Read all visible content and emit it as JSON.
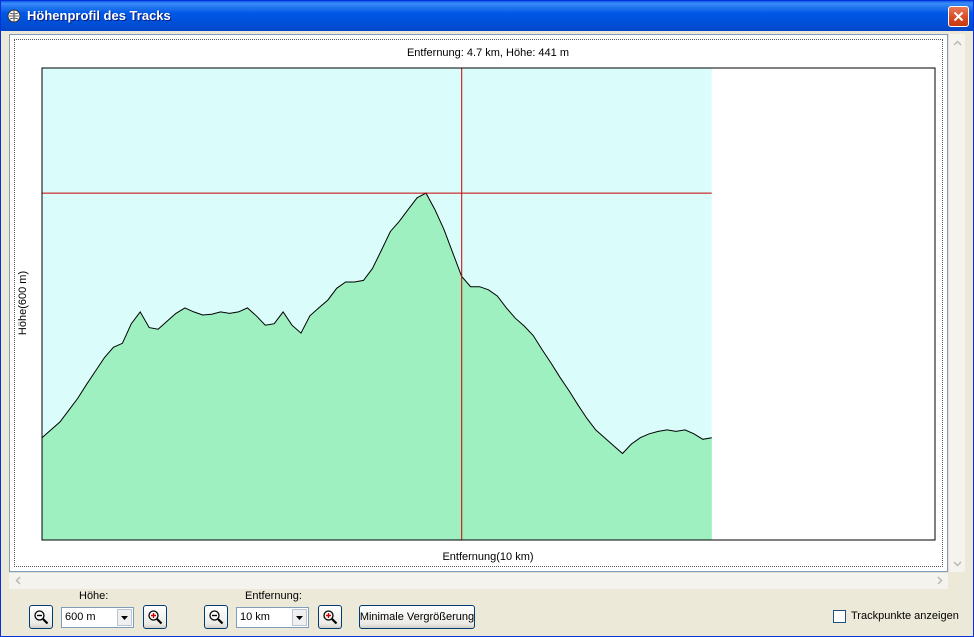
{
  "window": {
    "title": "Höhenprofil des Tracks"
  },
  "chart": {
    "readout": "Entfernung: 4.7 km, Höhe: 441 m",
    "xlabel": "Entfernung(10 km)",
    "ylabel": "Höhe(600 m)"
  },
  "chart_data": {
    "type": "area",
    "title": "Entfernung: 4.7 km, Höhe: 441 m",
    "xlabel": "Entfernung(10 km)",
    "ylabel": "Höhe(600 m)",
    "xlim": [
      0,
      10
    ],
    "ylim": [
      0,
      600
    ],
    "grid": false,
    "cursor": {
      "x": 4.7,
      "y": 441
    },
    "colors": {
      "sky": "#DAFDFC",
      "fill": "#9EF0C0",
      "line": "#000000",
      "cursor": "#CC0000"
    },
    "series": [
      {
        "x": [
          0,
          0.1,
          0.2,
          0.3,
          0.4,
          0.5,
          0.6,
          0.7,
          0.8,
          0.9,
          1.0,
          1.1,
          1.2,
          1.3,
          1.4,
          1.5,
          1.6,
          1.7,
          1.8,
          1.9,
          2.0,
          2.1,
          2.2,
          2.3,
          2.4,
          2.5,
          2.6,
          2.7,
          2.8,
          2.9,
          3.0,
          3.1,
          3.2,
          3.3,
          3.4,
          3.5,
          3.6,
          3.7,
          3.8,
          3.9,
          4.0,
          4.1,
          4.2,
          4.3,
          4.4,
          4.5,
          4.6,
          4.7,
          4.8,
          4.9,
          5.0,
          5.1,
          5.2,
          5.3,
          5.4,
          5.5,
          5.6,
          5.7,
          5.8,
          5.9,
          6.0,
          6.1,
          6.2,
          6.3,
          6.4,
          6.5,
          6.6,
          6.7,
          6.8,
          6.9,
          7.0,
          7.1,
          7.2,
          7.3,
          7.4,
          7.5
        ],
        "values": [
          130,
          140,
          150,
          165,
          180,
          198,
          215,
          232,
          245,
          250,
          275,
          290,
          270,
          268,
          278,
          288,
          295,
          290,
          286,
          287,
          290,
          288,
          290,
          295,
          285,
          273,
          275,
          290,
          273,
          263,
          285,
          295,
          305,
          320,
          328,
          328,
          330,
          345,
          368,
          392,
          405,
          420,
          435,
          441,
          420,
          395,
          365,
          335,
          322,
          322,
          318,
          310,
          295,
          282,
          272,
          260,
          242,
          225,
          207,
          190,
          172,
          155,
          140,
          130,
          120,
          110,
          122,
          130,
          135,
          138,
          140,
          138,
          140,
          135,
          128,
          130
        ]
      }
    ]
  },
  "controls": {
    "hoehe_label": "Höhe:",
    "hoehe_value": "600 m",
    "entfernung_label": "Entfernung:",
    "entfernung_value": "10 km",
    "min_zoom_label": "Minimale Vergrößerung",
    "trackpoints_label": "Trackpunkte anzeigen"
  }
}
